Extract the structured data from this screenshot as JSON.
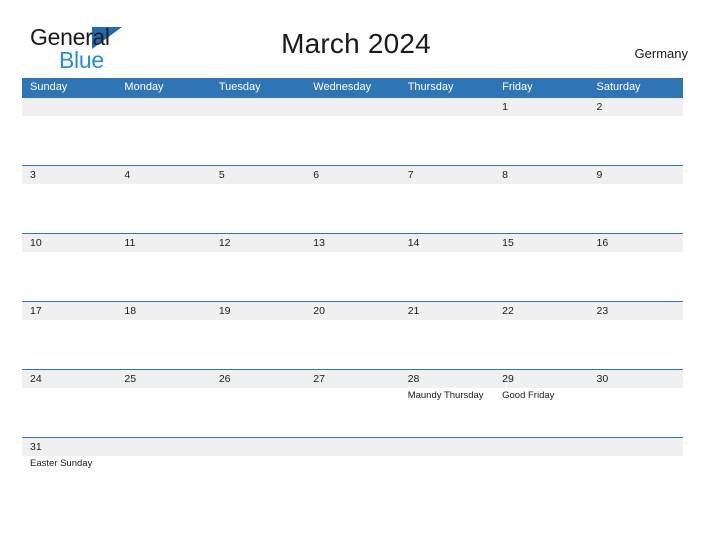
{
  "brand": {
    "line1": "General",
    "line2": "Blue",
    "triangle_color": "#1f6cb0",
    "blue_text_color": "#2b8ade"
  },
  "header": {
    "title": "March 2024",
    "country": "Germany",
    "header_bg": "#2e75b6",
    "band_bg": "#f0f0f0"
  },
  "calendar": {
    "weekdays": [
      "Sunday",
      "Monday",
      "Tuesday",
      "Wednesday",
      "Thursday",
      "Friday",
      "Saturday"
    ],
    "weeks": [
      [
        {
          "date": "",
          "event": ""
        },
        {
          "date": "",
          "event": ""
        },
        {
          "date": "",
          "event": ""
        },
        {
          "date": "",
          "event": ""
        },
        {
          "date": "",
          "event": ""
        },
        {
          "date": "1",
          "event": ""
        },
        {
          "date": "2",
          "event": ""
        }
      ],
      [
        {
          "date": "3",
          "event": ""
        },
        {
          "date": "4",
          "event": ""
        },
        {
          "date": "5",
          "event": ""
        },
        {
          "date": "6",
          "event": ""
        },
        {
          "date": "7",
          "event": ""
        },
        {
          "date": "8",
          "event": ""
        },
        {
          "date": "9",
          "event": ""
        }
      ],
      [
        {
          "date": "10",
          "event": ""
        },
        {
          "date": "11",
          "event": ""
        },
        {
          "date": "12",
          "event": ""
        },
        {
          "date": "13",
          "event": ""
        },
        {
          "date": "14",
          "event": ""
        },
        {
          "date": "15",
          "event": ""
        },
        {
          "date": "16",
          "event": ""
        }
      ],
      [
        {
          "date": "17",
          "event": ""
        },
        {
          "date": "18",
          "event": ""
        },
        {
          "date": "19",
          "event": ""
        },
        {
          "date": "20",
          "event": ""
        },
        {
          "date": "21",
          "event": ""
        },
        {
          "date": "22",
          "event": ""
        },
        {
          "date": "23",
          "event": ""
        }
      ],
      [
        {
          "date": "24",
          "event": ""
        },
        {
          "date": "25",
          "event": ""
        },
        {
          "date": "26",
          "event": ""
        },
        {
          "date": "27",
          "event": ""
        },
        {
          "date": "28",
          "event": "Maundy Thursday"
        },
        {
          "date": "29",
          "event": "Good Friday"
        },
        {
          "date": "30",
          "event": ""
        }
      ],
      [
        {
          "date": "31",
          "event": "Easter Sunday"
        },
        {
          "date": "",
          "event": ""
        },
        {
          "date": "",
          "event": ""
        },
        {
          "date": "",
          "event": ""
        },
        {
          "date": "",
          "event": ""
        },
        {
          "date": "",
          "event": ""
        },
        {
          "date": "",
          "event": ""
        }
      ]
    ]
  }
}
